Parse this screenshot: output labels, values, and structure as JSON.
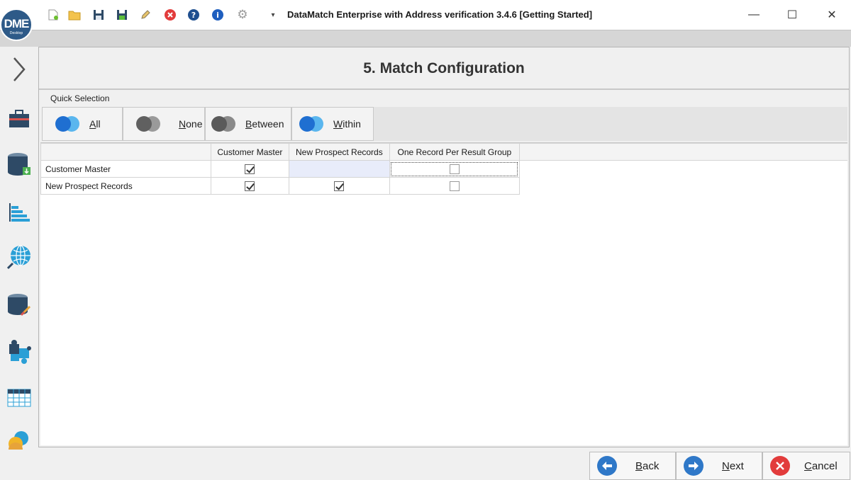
{
  "app": {
    "logo_text": "DME",
    "logo_sub": "Desktop",
    "window_title": "DataMatch Enterprise with Address verification 3.4.6 [Getting Started]"
  },
  "quick_access_icons": [
    "new-file-icon",
    "open-folder-icon",
    "save-icon",
    "save-as-icon",
    "edit-icon",
    "close-red-icon",
    "help-icon",
    "info-icon",
    "settings-gear-icon",
    "customize-dropdown-icon"
  ],
  "window_controls": {
    "minimize": "—",
    "maximize": "☐",
    "close": "✕"
  },
  "sidebar_icons": [
    "expand-chevron-icon",
    "project-briefcase-icon",
    "data-import-icon",
    "profile-chart-icon",
    "address-globe-icon",
    "data-cleanse-icon",
    "match-puzzle-icon",
    "results-grid-icon",
    "merge-icon"
  ],
  "page": {
    "title": "5. Match Configuration"
  },
  "quick_selection": {
    "label": "Quick Selection",
    "buttons": [
      {
        "mnemonic": "A",
        "rest": "ll",
        "colors": [
          "#1f6fd1",
          "#5ab6ee"
        ]
      },
      {
        "mnemonic": "N",
        "rest": "one",
        "colors": [
          "#606060",
          "#9a9a9a"
        ]
      },
      {
        "mnemonic": "B",
        "rest": "etween",
        "colors": [
          "#5a5a5a",
          "#8a8a8a"
        ]
      },
      {
        "mnemonic": "W",
        "rest": "ithin",
        "colors": [
          "#1f6fd1",
          "#5ab6ee"
        ]
      }
    ]
  },
  "grid": {
    "columns": [
      "",
      "Customer Master",
      "New Prospect Records",
      "One Record Per Result Group"
    ],
    "rows": [
      {
        "label": "Customer Master",
        "customer_master": true,
        "new_prospect": null,
        "one_per_group": false
      },
      {
        "label": "New Prospect Records",
        "customer_master": true,
        "new_prospect": true,
        "one_per_group": false
      }
    ]
  },
  "footer": {
    "back": {
      "mnemonic": "B",
      "rest": "ack"
    },
    "next": {
      "mnemonic": "N",
      "rest": "ext"
    },
    "cancel": {
      "mnemonic": "C",
      "rest": "ancel"
    }
  },
  "colors": {
    "accent": "#2e5a88",
    "nav_blue": "#2f78c8",
    "cancel_red": "#e23c3c"
  }
}
